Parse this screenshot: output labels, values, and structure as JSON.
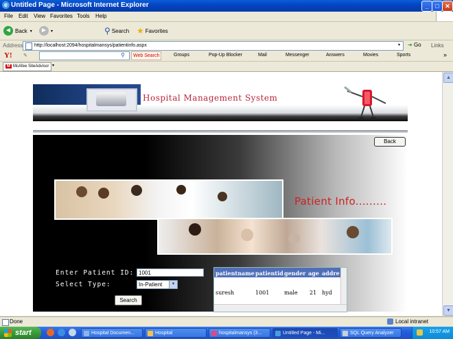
{
  "window": {
    "title": "Untitled Page - Microsoft Internet Explorer"
  },
  "menu": [
    "File",
    "Edit",
    "View",
    "Favorites",
    "Tools",
    "Help"
  ],
  "toolbar": {
    "back": "Back",
    "search": "Search",
    "favorites": "Favorites"
  },
  "address": {
    "label": "Address",
    "url": "http://localhost:2094/hospitalmansys/patientinfo.aspx",
    "go": "Go",
    "links": "Links"
  },
  "yahoo": {
    "web_search": "Web Search",
    "items": [
      "Groups",
      "Pop-Up Blocker",
      "Mail",
      "Messenger",
      "Answers",
      "Movies",
      "Sports"
    ]
  },
  "mcafee": {
    "label": "McAfee SiteAdvisor"
  },
  "banner": {
    "title": "Hospital Management System"
  },
  "page": {
    "back_label": "Back",
    "heading": "Patient Info.........",
    "patient_id_label": "Enter Patient ID:",
    "patient_id_value": "1001",
    "select_type_label": "Select Type:",
    "select_type_value": "In-Patient",
    "search_label": "Search"
  },
  "grid": {
    "headers": [
      "patientname",
      "patientid",
      "gender",
      "age",
      "addre"
    ],
    "rows": [
      [
        "suresh",
        "1001",
        "male",
        "21",
        "hyd"
      ]
    ]
  },
  "status": {
    "left": "Done",
    "zone": "Local intranet"
  },
  "taskbar": {
    "start": "start",
    "tasks": [
      "Hospital Documen...",
      "Hospital",
      "hospitalmansys (3...",
      "Untitled Page - Mi...",
      "SQL Query Analyzer"
    ],
    "clock": "10:57 AM"
  }
}
